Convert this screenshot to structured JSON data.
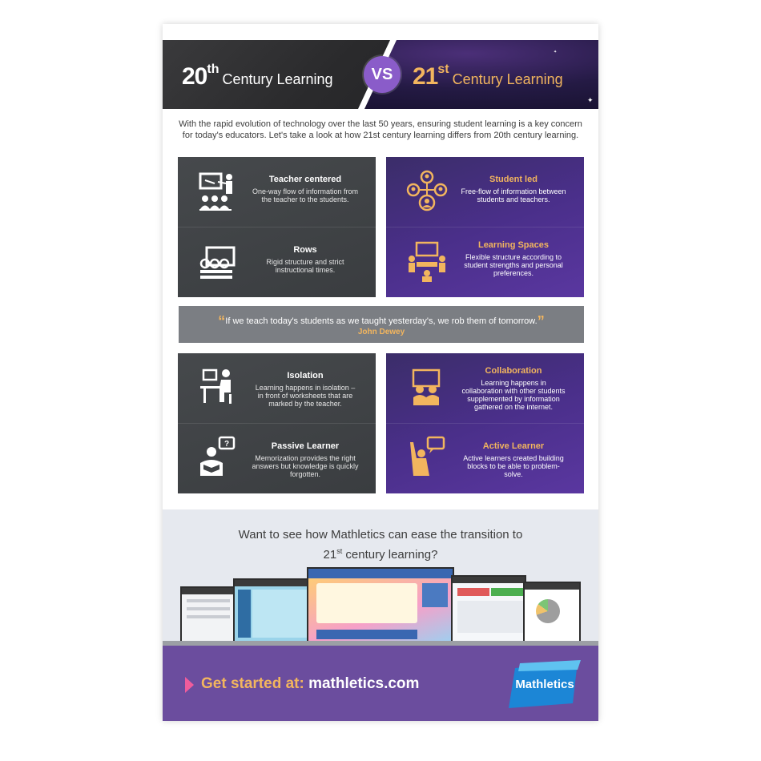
{
  "header": {
    "left": {
      "num": "20",
      "sup": "th",
      "label": "Century Learning"
    },
    "vs": "VS",
    "right": {
      "num": "21",
      "sup": "st",
      "label": "Century Learning"
    }
  },
  "intro": "With the rapid evolution of technology over the last 50 years, ensuring student learning is a key concern for today's educators. Let's take a look at how 21st century learning differs from 20th century learning.",
  "blocks": [
    {
      "dark": [
        {
          "title": "Teacher centered",
          "desc": "One-way flow of information from the teacher to the students.",
          "icon": "teacher-board-icon"
        },
        {
          "title": "Rows",
          "desc": "Rigid structure and strict instructional times.",
          "icon": "classroom-rows-icon"
        }
      ],
      "purple": [
        {
          "title": "Student led",
          "desc": "Free-flow of information between students and teachers.",
          "icon": "student-network-icon"
        },
        {
          "title": "Learning Spaces",
          "desc": "Flexible structure according to student strengths and personal preferences.",
          "icon": "group-table-icon"
        }
      ]
    },
    {
      "dark": [
        {
          "title": "Isolation",
          "desc": "Learning happens in isolation – in front of worksheets that are marked by the teacher.",
          "icon": "desk-student-icon"
        },
        {
          "title": "Passive Learner",
          "desc": "Memorization provides the right answers but knowledge is quickly forgotten.",
          "icon": "reading-question-icon"
        }
      ],
      "purple": [
        {
          "title": "Collaboration",
          "desc": "Learning happens in collaboration with other students supplemented by information gathered on the internet.",
          "icon": "collaboration-screen-icon"
        },
        {
          "title": "Active Learner",
          "desc": "Active learners created building blocks to be able to problem-solve.",
          "icon": "raised-hand-speech-icon"
        }
      ]
    }
  ],
  "quote": {
    "text": "If we teach today's students as we taught yesterday's, we rob them of tomorrow.",
    "author": "John Dewey"
  },
  "promo": {
    "line1": "Want to see how Mathletics can ease the transition to",
    "line2_num": "21",
    "line2_sup": "st",
    "line2_rest": " century learning?"
  },
  "cta": {
    "prefix": "Get started at: ",
    "url": "mathletics.com"
  },
  "logo": "Mathletics",
  "colors": {
    "accent": "#f2b55e",
    "purple": "#6b4d9e",
    "dark": "#3f4245",
    "pink": "#f05c9c"
  }
}
